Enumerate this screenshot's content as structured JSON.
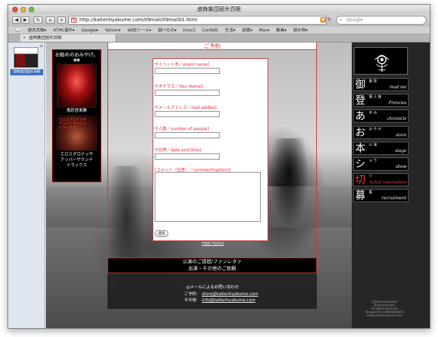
{
  "window": {
    "title": "虚飾集団廻天百眼"
  },
  "toolbar": {
    "back": "◀",
    "forward": "▶",
    "reload": "↻",
    "home": "⌂",
    "add": "+",
    "url": "http://kaitenhyakume.com/09mail/09mail01.html",
    "search_placeholder": "Google"
  },
  "bookmarks": [
    "廻天百眼▾",
    "HTML操作▾",
    "Google▾",
    "Yahoo!▾",
    "WEBツール▾",
    "調べもの▾",
    "[mixi]",
    "Confetti",
    "生活▾",
    "読書▾",
    "Mac▾",
    "動画▾",
    "読み物▾"
  ],
  "tab": {
    "label": "虚飾集団廻天百眼"
  },
  "sidebar": {
    "thumb_label": "虚飾集団廻天百眼"
  },
  "promo": {
    "title": "お勧めのおみやげ。",
    "dots": "■■",
    "item1": "鬼慰音楽集",
    "item2_overlay": "エロスグロテッサ\nアッパーサウンド\nトラックス",
    "item2": "エロスグロテッサ\nアッパーサウンド\nトラックス"
  },
  "form": {
    "heading": "ご予約",
    "fields": [
      {
        "label": "*[イベント名／event name]"
      },
      {
        "label": "*[オナマエ／Your Name]"
      },
      {
        "label": "*[メールアドレス／mail addles]"
      },
      {
        "label": "*[人数／number of people]"
      },
      {
        "label": "*[日時／date and time]"
      }
    ],
    "comment_label": "[コメント（任意）／comment(option)]",
    "send": "送信",
    "fina_tools": "FINA TOOLS"
  },
  "center_bars": [
    "公演のご感想/ファンレタァ",
    "出演・その他のご依頼"
  ],
  "contact": {
    "title": "◎メールによるお問い合わせ",
    "rows": [
      {
        "k": "ご予約",
        "v": "store@kaitenhyakume.com"
      },
      {
        "k": "その他",
        "v": "info@kaitenhyakume.com"
      }
    ]
  },
  "menu": [
    {
      "k": "御",
      "s": "挨 拶",
      "e": "read me",
      "red": false
    },
    {
      "k": "登",
      "s": "場 人 物",
      "e": "Frenzies",
      "red": false
    },
    {
      "k": "あ",
      "s": "ゆ み",
      "e": "chronicle",
      "red": false
    },
    {
      "k": "お",
      "s": "み や げ",
      "e": "store",
      "red": false
    },
    {
      "k": "本",
      "s": "公 演",
      "e": "stage",
      "red": false
    },
    {
      "k": "シ",
      "s": "ョ ウ",
      "e": "show",
      "red": false
    },
    {
      "k": "切",
      "s": "符",
      "e": "ticket reservation",
      "red": true
    },
    {
      "k": "募",
      "s": "集",
      "e": "recruitment",
      "red": false
    }
  ],
  "copyright": "(C)KaitenHyakume Shashinshudan\nAll Rights Reserved\nDesigned by SOKAIDEMARU\ninfo@kaitenhyakume.com"
}
